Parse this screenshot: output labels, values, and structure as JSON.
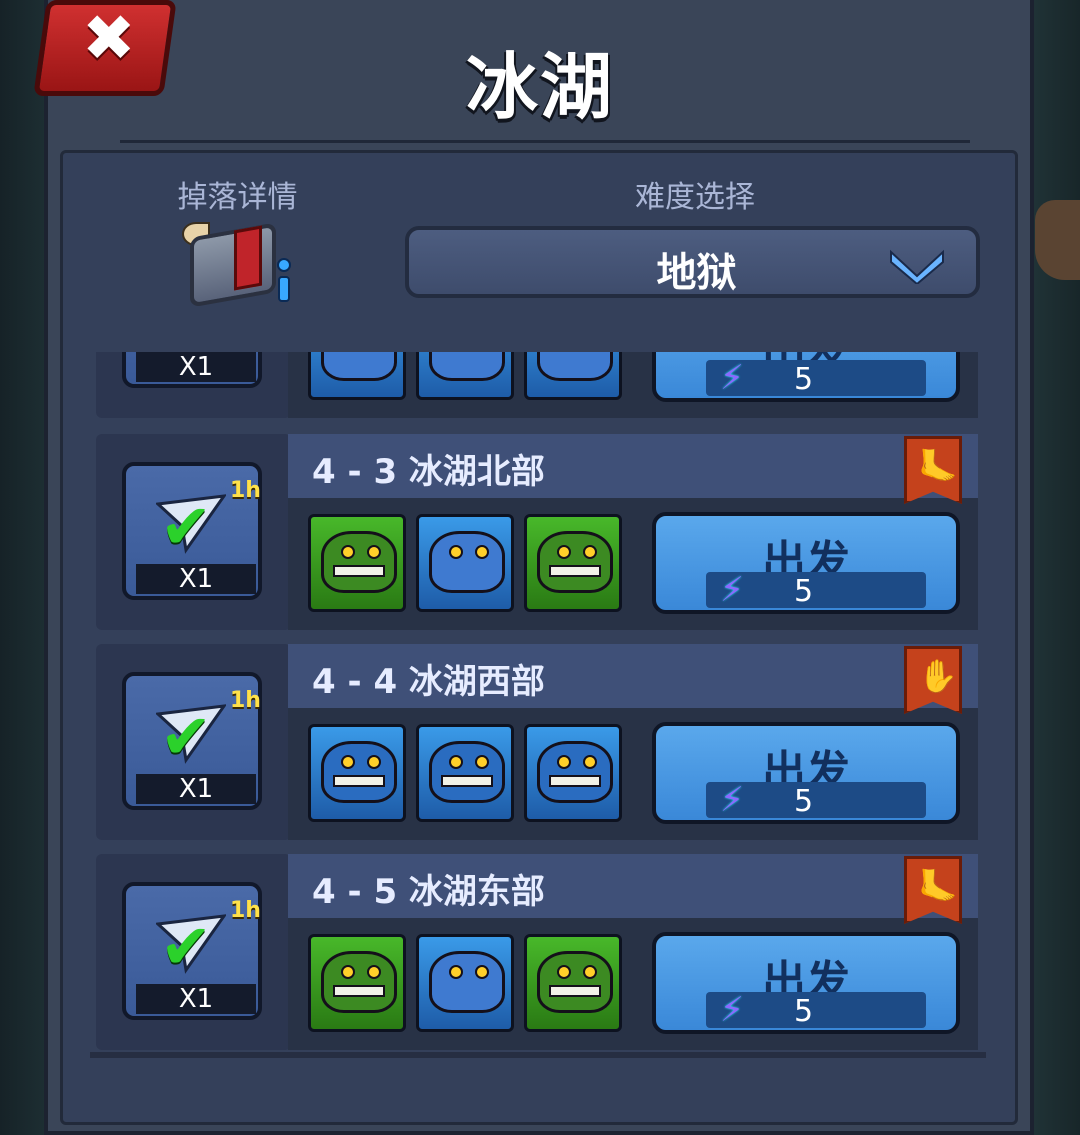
{
  "window": {
    "title": "冰湖",
    "close_icon": "close-icon"
  },
  "drop": {
    "label": "掉落详情",
    "icon": "treasure-chest-icon"
  },
  "difficulty": {
    "label": "难度选择",
    "selected": "地狱",
    "icon": "chevron-down-icon"
  },
  "partial_row": {
    "reward_qty": "X1",
    "button_label": "出发",
    "cost": "5"
  },
  "stages": [
    {
      "name": "4 - 3 冰湖北部",
      "badge_icon": "foot-icon",
      "badge_glyph": "🦶",
      "reward_time": "1h",
      "reward_qty": "X1",
      "enemies": [
        "croc-green",
        "bear",
        "croc-green"
      ],
      "button_label": "出发",
      "cost": "5"
    },
    {
      "name": "4 - 4 冰湖西部",
      "badge_icon": "hand-icon",
      "badge_glyph": "✋",
      "reward_time": "1h",
      "reward_qty": "X1",
      "enemies": [
        "croc-blue",
        "croc-blue",
        "croc-blue"
      ],
      "button_label": "出发",
      "cost": "5"
    },
    {
      "name": "4 - 5 冰湖东部",
      "badge_icon": "foot-icon",
      "badge_glyph": "🦶",
      "reward_time": "1h",
      "reward_qty": "X1",
      "enemies": [
        "croc-green",
        "bear",
        "croc-green"
      ],
      "button_label": "出发",
      "cost": "5"
    }
  ],
  "colors": {
    "panel": "#3a4558",
    "button": "#4a98e2",
    "badge": "#c5421c",
    "check": "#2bd12b"
  }
}
